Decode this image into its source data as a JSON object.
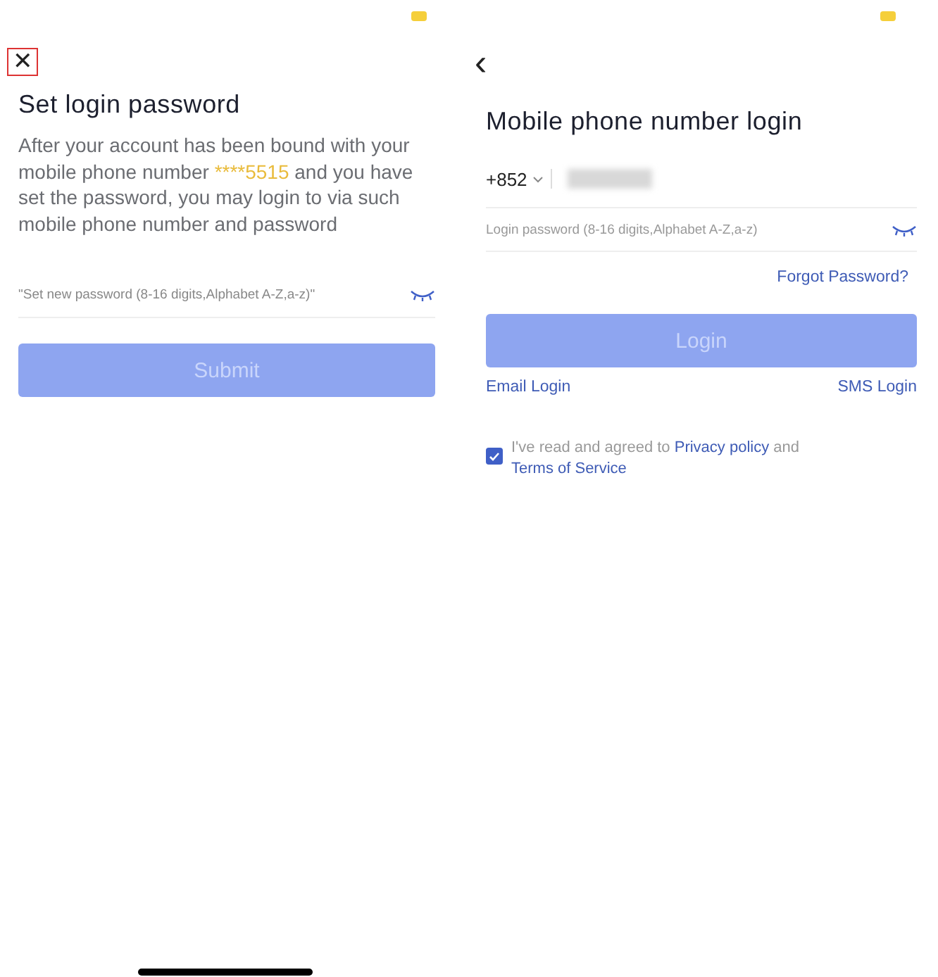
{
  "left_screen": {
    "close_button": {
      "label": "✕",
      "highlighted": true
    },
    "title": "Set login password",
    "description": {
      "before": "After your account has been bound with your mobile phone number",
      "phone": "****5515",
      "after": "and you have set the password, you may login to via such mobile phone number and password"
    },
    "password_field": {
      "placeholder": "\"Set new password (8-16 digits,Alphabet A-Z,a-z)\""
    },
    "submit_button": {
      "label": "Submit",
      "disabled": true
    }
  },
  "right_screen": {
    "back_button": {
      "label": "‹"
    },
    "title": "Mobile phone number login",
    "country_code": "+852",
    "password_field": {
      "placeholder": "Login password (8-16 digits,Alphabet A-Z,a-z)"
    },
    "forgot_link": "Forgot Password?",
    "login_button": {
      "label": "Login",
      "disabled": true
    },
    "email_login": "Email Login",
    "sms_login": "SMS Login",
    "agreement": {
      "checked": true,
      "text": "I've read and agreed to",
      "privacy_link": "Privacy policy",
      "and": "and",
      "terms_link": "Terms of Service"
    }
  }
}
